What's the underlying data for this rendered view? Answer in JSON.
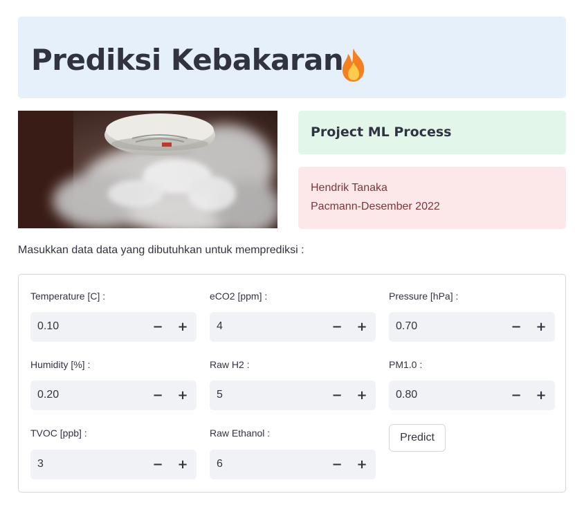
{
  "header": {
    "title": "Prediksi Kebakaran",
    "emoji_icon": "fire-icon"
  },
  "image": {
    "icon": "smoke-detector-photo"
  },
  "project_box": {
    "label": "Project ML Process",
    "background": "#e3f6ea"
  },
  "author_box": {
    "name": "Hendrik Tanaka",
    "org": "Pacmann-Desember 2022",
    "background": "#fde8e9",
    "text_color": "#7d353b"
  },
  "instruction": "Masukkan data data yang dibutuhkan untuk memprediksi :",
  "form": {
    "fields": [
      {
        "label": "Temperature [C] :",
        "value": "0.10"
      },
      {
        "label": "eCO2 [ppm] :",
        "value": "4"
      },
      {
        "label": "Pressure [hPa] :",
        "value": "0.70"
      },
      {
        "label": "Humidity [%] :",
        "value": "0.20"
      },
      {
        "label": "Raw H2 :",
        "value": "5"
      },
      {
        "label": "PM1.0 :",
        "value": "0.80"
      },
      {
        "label": "TVOC [ppb] :",
        "value": "3"
      },
      {
        "label": "Raw Ethanol :",
        "value": "6"
      }
    ],
    "minus_symbol": "−",
    "plus_symbol": "+",
    "predict_label": "Predict"
  },
  "colors": {
    "title_bg": "#e6f0fb",
    "input_bg": "#f0f2f6",
    "text": "#31333f"
  }
}
